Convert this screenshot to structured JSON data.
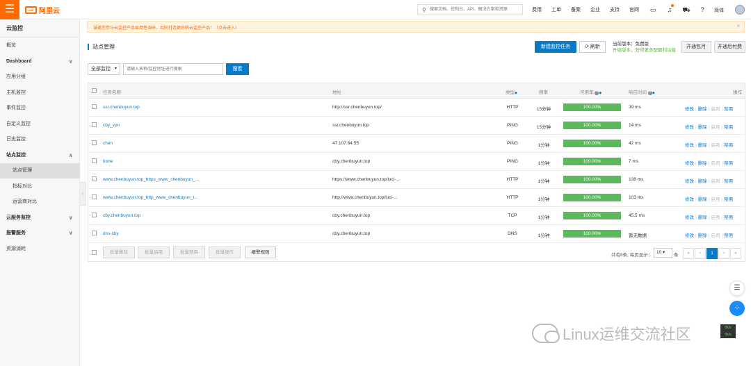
{
  "topbar": {
    "menu_icon": "hamburger-icon",
    "logo_text": "阿里云",
    "search_placeholder": "搜索文档、控制台、API、解决方案和资源",
    "nav": [
      "费用",
      "工单",
      "备案",
      "企业",
      "支持",
      "官网"
    ],
    "icons": [
      "screen-icon",
      "bell-icon",
      "cart-icon",
      "help-icon"
    ],
    "lang": "简体"
  },
  "sidebar": {
    "title": "云监控",
    "items": [
      {
        "label": "概览",
        "kind": "item"
      },
      {
        "label": "Dashboard",
        "kind": "group",
        "chev": "∨"
      },
      {
        "label": "应用分组",
        "kind": "item"
      },
      {
        "label": "主机监控",
        "kind": "item"
      },
      {
        "label": "事件监控",
        "kind": "item"
      },
      {
        "label": "自定义监控",
        "kind": "item"
      },
      {
        "label": "日志监控",
        "kind": "item"
      },
      {
        "label": "站点监控",
        "kind": "group",
        "chev": "∧"
      },
      {
        "label": "站点管理",
        "kind": "sub",
        "active": true
      },
      {
        "label": "指标对比",
        "kind": "sub"
      },
      {
        "label": "运营商对比",
        "kind": "sub"
      },
      {
        "label": "云服务监控",
        "kind": "group",
        "chev": "∨"
      },
      {
        "label": "报警服务",
        "kind": "group",
        "chev": "∨"
      },
      {
        "label": "资源消耗",
        "kind": "item"
      }
    ]
  },
  "notice": {
    "text": "诚邀您参与云监控产品易用性调研，共同打造更好的云监控产品！（点击进入）",
    "close": "×"
  },
  "header": {
    "title": "站点管理",
    "new_task": "新建监控任务",
    "refresh": "刷新",
    "version_label": "当前版本：免费版",
    "upgrade_text": "升级版本，获得更多配额和功能",
    "monthly": "开通包月",
    "postpaid": "开通后付费"
  },
  "filter": {
    "select_value": "全部监控",
    "input_placeholder": "请输入名称/监控地址进行搜索",
    "search_button": "搜索"
  },
  "table": {
    "headers": {
      "name": "任务名称",
      "address": "地址",
      "type": "类型",
      "freq": "频率",
      "availability": "可用率",
      "response": "响应时间",
      "ops": "操作"
    },
    "rows": [
      {
        "name": "ssr.chenbuyun.top",
        "address": "http://ssr.chenbuyun.top/",
        "type": "HTTP",
        "freq": "15分钟",
        "availability": "100.00%",
        "availability_fraction": 1.0,
        "response": "39 ms"
      },
      {
        "name": "cby_vpn",
        "address": "ssr.chenbuyun.top",
        "type": "PING",
        "freq": "15分钟",
        "availability": "100.00%",
        "availability_fraction": 1.0,
        "response": "14 ms"
      },
      {
        "name": "chen",
        "address": "47.107.84.55",
        "type": "PING",
        "freq": "1分钟",
        "availability": "100.00%",
        "availability_fraction": 1.0,
        "response": "42 ms"
      },
      {
        "name": "hone",
        "address": "cby.chenbuyun.top",
        "type": "PING",
        "freq": "1分钟",
        "availability": "100.00%",
        "availability_fraction": 1.0,
        "response": "7 ms"
      },
      {
        "name": "www.chenbuyun.top_https_www_chenbuyun_...",
        "address": "https://www.chenbuyun.top/luci-...",
        "type": "HTTP",
        "freq": "1分钟",
        "availability": "100.00%",
        "availability_fraction": 1.0,
        "response": "138 ms"
      },
      {
        "name": "www.chenbuyun.top_http_www_chenbuyun_t...",
        "address": "http://www.chenbuyun.top/luci-...",
        "type": "HTTP",
        "freq": "1分钟",
        "availability": "100.00%",
        "availability_fraction": 1.0,
        "response": "103 ms"
      },
      {
        "name": "cby.chenbuyun.top",
        "address": "cby.chenbuyun.top",
        "type": "TCP",
        "freq": "1分钟",
        "availability": "100.00%",
        "availability_fraction": 1.0,
        "response": "45.5 ms"
      },
      {
        "name": "dns-cby",
        "address": "cby.chenbuyun.top",
        "type": "DNS",
        "freq": "1分钟",
        "availability": "100.00%",
        "availability_fraction": 1.0,
        "response": "暂无数据"
      }
    ],
    "ops": {
      "edit": "修改",
      "delete": "删除",
      "enable": "启用",
      "disable": "禁用",
      "sep": "|"
    }
  },
  "footer": {
    "batch_delete": "批量删除",
    "batch_enable": "批量启用",
    "batch_disable": "批量禁用",
    "batch_ops": "批量操作",
    "alarm_rules": "报警规则",
    "total_text": "共有8条, 每页显示：",
    "page_size": "10",
    "unit": "条",
    "pages": [
      "«",
      "‹",
      "1",
      "›",
      "»"
    ],
    "current_page": "1"
  },
  "watermark": {
    "text": "Linux运维交流社区"
  },
  "net_speed": {
    "up": "0k/s",
    "down": "0k/s"
  },
  "colors": {
    "accent": "#0a7ac6",
    "brand": "#ff6a00",
    "success": "#5cb85c"
  }
}
